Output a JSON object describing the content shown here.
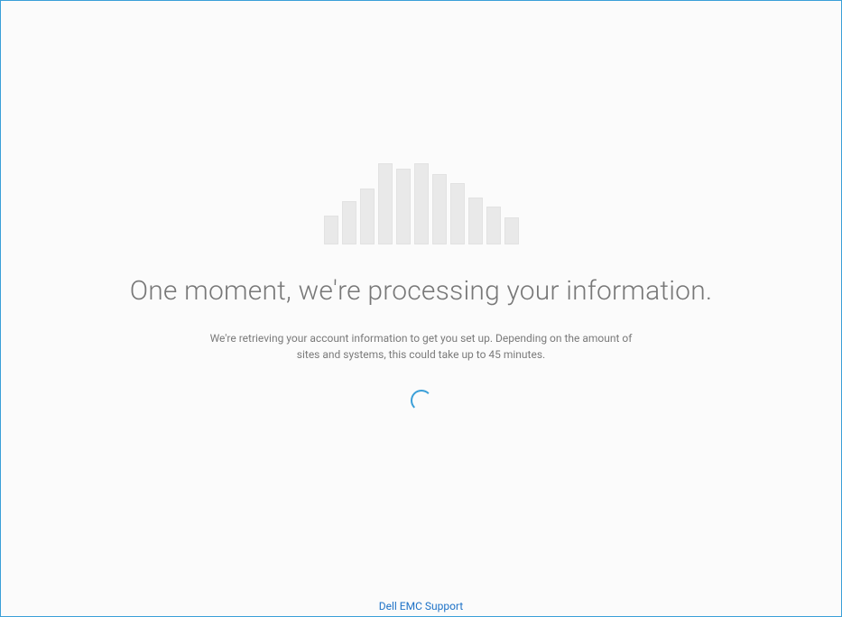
{
  "loading": {
    "heading": "One moment, we're processing your information.",
    "subtext_line1": "We're retrieving your account information to get you set up. Depending on the amount of",
    "subtext_line2": "sites and systems, this could take up to 45 minutes."
  },
  "footer": {
    "support_link_text": "Dell EMC Support"
  },
  "colors": {
    "accent": "#3a9fd8",
    "text_primary": "#777777",
    "text_secondary": "#7a7a7a",
    "bar_fill": "#e9e9e9"
  }
}
